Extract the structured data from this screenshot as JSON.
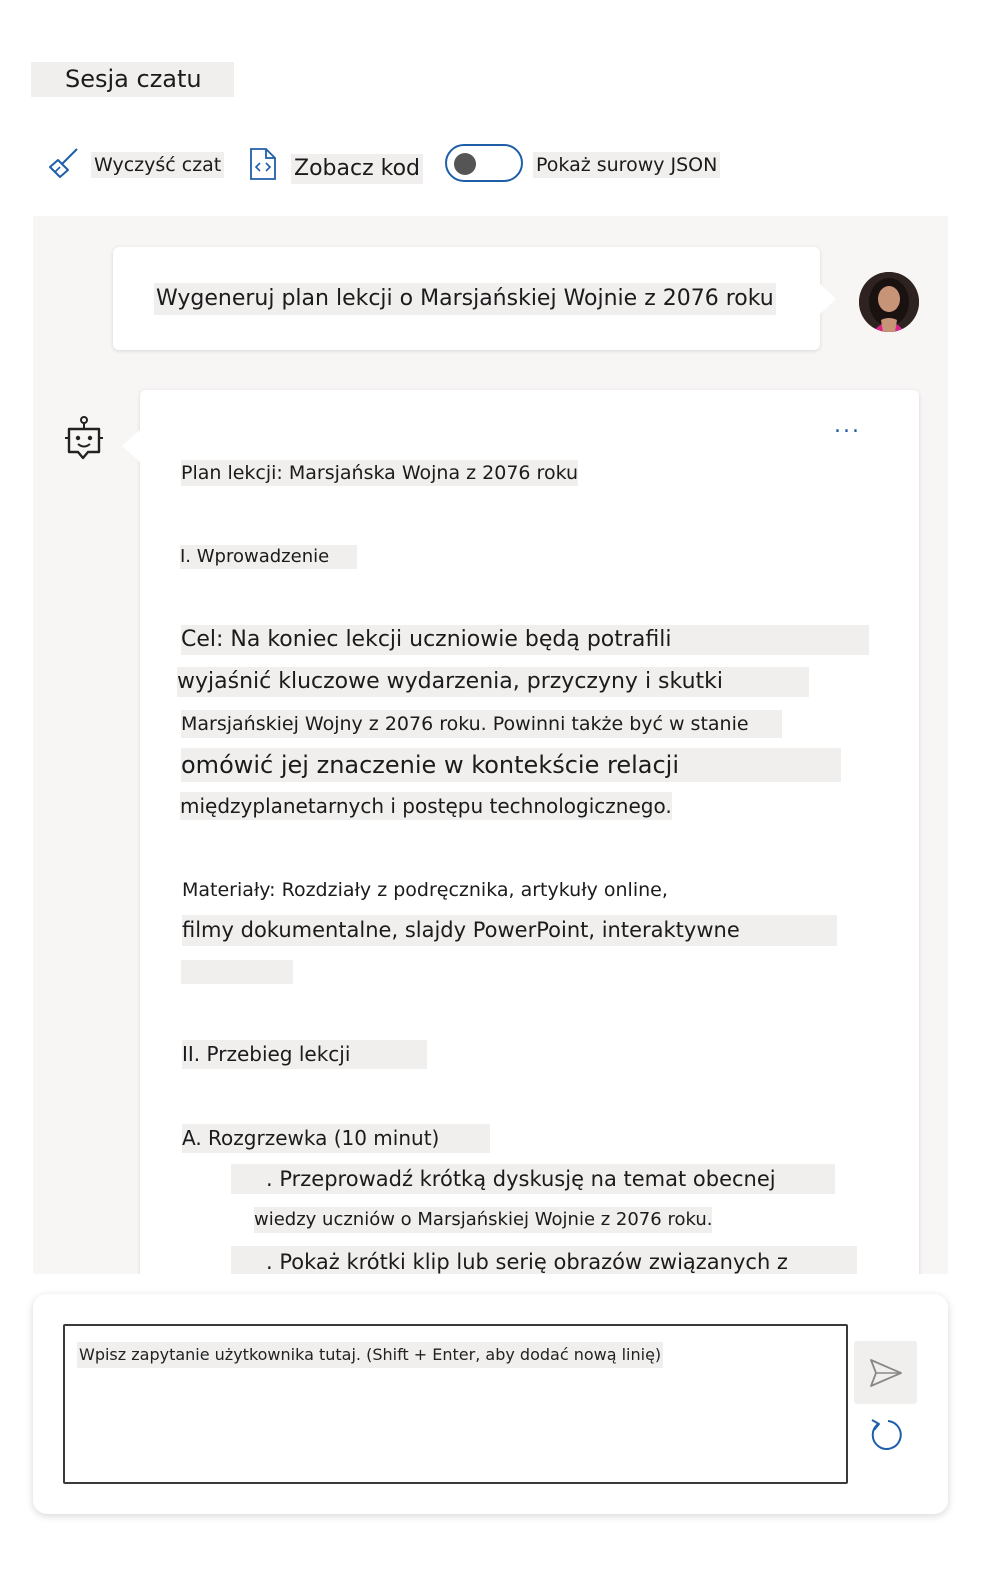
{
  "session": {
    "title": "Sesja czatu"
  },
  "toolbar": {
    "clear_label": "Wyczyść czat",
    "view_code_label": "Zobacz kod",
    "raw_json_label": "Pokaż surowy JSON",
    "raw_json_on": false,
    "icons": {
      "clear": "broom-icon",
      "code": "code-file-icon"
    }
  },
  "chat": {
    "user_message": "Wygeneruj plan lekcji o Marsjańskiej Wojnie z 2076 roku",
    "more_label": "...",
    "assistant_lines": [
      "Plan lekcji: Marsjańska Wojna z 2076 roku",
      "I. Wprowadzenie",
      "Cel: Na koniec lekcji uczniowie będą potrafili",
      "wyjaśnić kluczowe wydarzenia, przyczyny i skutki",
      "Marsjańskiej Wojny z 2076 roku. Powinni także być w stanie",
      "omówić jej znaczenie w kontekście relacji",
      "międzyplanetarnych i postępu technologicznego.",
      "Materiały: Rozdziały z podręcznika, artykuły online,",
      "filmy dokumentalne, slajdy PowerPoint, interaktywne",
      "II. Przebieg lekcji",
      "A. Rozgrzewka (10 minut)",
      ". Przeprowadź krótką dyskusję na temat obecnej",
      "wiedzy uczniów o Marsjańskiej Wojnie z 2076 roku.",
      ". Pokaż krótki klip lub serię obrazów związanych z"
    ]
  },
  "input": {
    "placeholder": "Wpisz zapytanie użytkownika tutaj. (Shift + Enter, aby dodać nową linię)"
  },
  "colors": {
    "accent": "#1f5faa",
    "chat_bg": "#f7f6f5",
    "highlight": "#f0efee"
  }
}
